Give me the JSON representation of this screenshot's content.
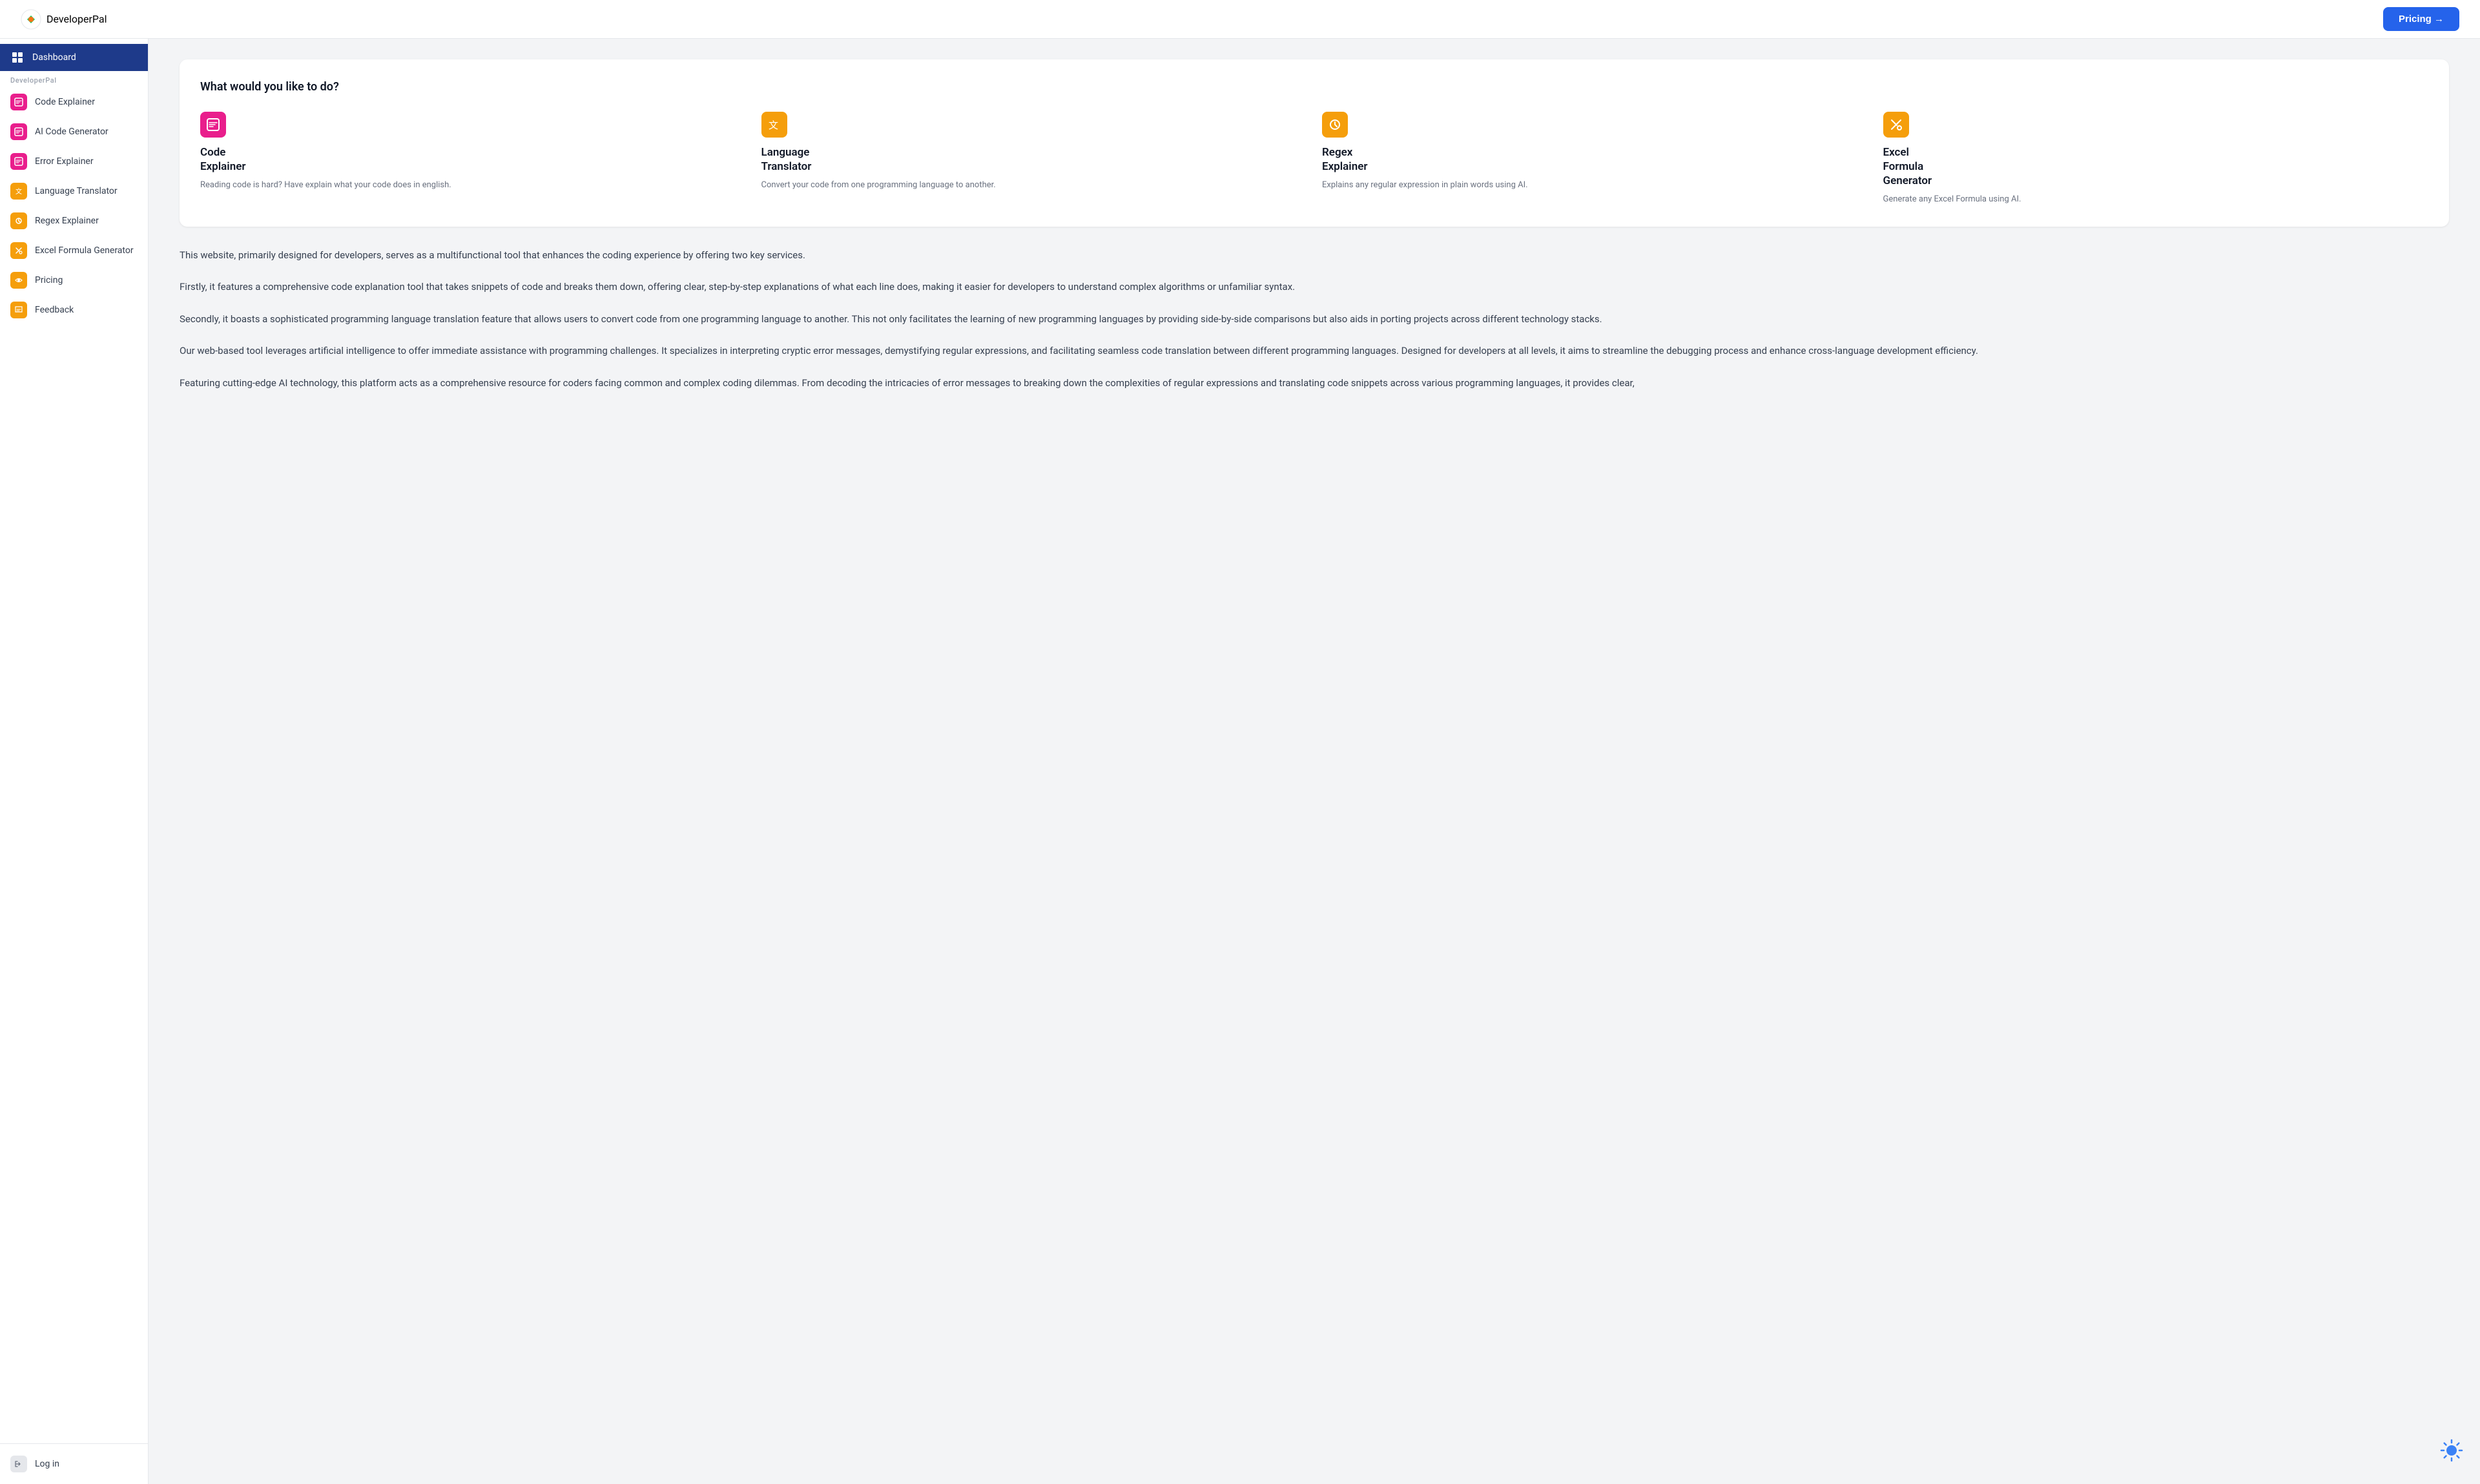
{
  "header": {
    "logo_text": "DeveloperPal",
    "pricing_button": "Pricing →"
  },
  "sidebar": {
    "section_label": "DeveloperPal",
    "active_item": "Dashboard",
    "items": [
      {
        "id": "dashboard",
        "label": "Dashboard",
        "icon": "⊞",
        "icon_type": "active"
      },
      {
        "id": "code-explainer",
        "label": "Code Explainer",
        "icon": "💬",
        "icon_type": "pink"
      },
      {
        "id": "ai-code-generator",
        "label": "AI Code Generator",
        "icon": "💬",
        "icon_type": "pink"
      },
      {
        "id": "error-explainer",
        "label": "Error Explainer",
        "icon": "💬",
        "icon_type": "pink"
      },
      {
        "id": "language-translator",
        "label": "Language Translator",
        "icon": "✕",
        "icon_type": "orange"
      },
      {
        "id": "regex-explainer",
        "label": "Regex Explainer",
        "icon": "✦",
        "icon_type": "orange"
      },
      {
        "id": "excel-formula-generator",
        "label": "Excel Formula Generator",
        "icon": "✏",
        "icon_type": "orange"
      },
      {
        "id": "pricing",
        "label": "Pricing",
        "icon": "✏",
        "icon_type": "orange"
      },
      {
        "id": "feedback",
        "label": "Feedback",
        "icon": "✏",
        "icon_type": "orange"
      }
    ],
    "login": {
      "label": "Log in"
    }
  },
  "main": {
    "card": {
      "title": "What would you like to do?",
      "tools": [
        {
          "id": "code-explainer",
          "name": "Code Explainer",
          "desc": "Reading code is hard? Have explain what your code does in english.",
          "icon": "💬",
          "icon_color": "#e91e8c"
        },
        {
          "id": "language-translator",
          "name": "Language Translator",
          "desc": "Convert your code from one programming language to another.",
          "icon": "✕",
          "icon_color": "#f59e0b"
        },
        {
          "id": "regex-explainer",
          "name": "Regex Explainer",
          "desc": "Explains any regular expression in plain words using AI.",
          "icon": "✦",
          "icon_color": "#f59e0b"
        },
        {
          "id": "excel-formula-generator",
          "name": "Excel Formula Generator",
          "desc": "Generate any Excel Formula using AI.",
          "icon": "✏",
          "icon_color": "#f59e0b"
        }
      ]
    },
    "paragraphs": [
      "This website, primarily designed for developers, serves as a multifunctional tool that enhances the coding experience by offering two key services.",
      "Firstly, it features a comprehensive code explanation tool that takes snippets of code and breaks them down, offering clear, step-by-step explanations of what each line does, making it easier for developers to understand complex algorithms or unfamiliar syntax.",
      "Secondly, it boasts a sophisticated programming language translation feature that allows users to convert code from one programming language to another. This not only facilitates the learning of new programming languages by providing side-by-side comparisons but also aids in porting projects across different technology stacks.",
      "Our web-based tool leverages artificial intelligence to offer immediate assistance with programming challenges. It specializes in interpreting cryptic error messages, demystifying regular expressions, and facilitating seamless code translation between different programming languages. Designed for developers at all levels, it aims to streamline the debugging process and enhance cross-language development efficiency.",
      "Featuring cutting-edge AI technology, this platform acts as a comprehensive resource for coders facing common and complex coding dilemmas. From decoding the intricacies of error messages to breaking down the complexities of regular expressions and translating code snippets across various programming languages, it provides clear,"
    ]
  }
}
